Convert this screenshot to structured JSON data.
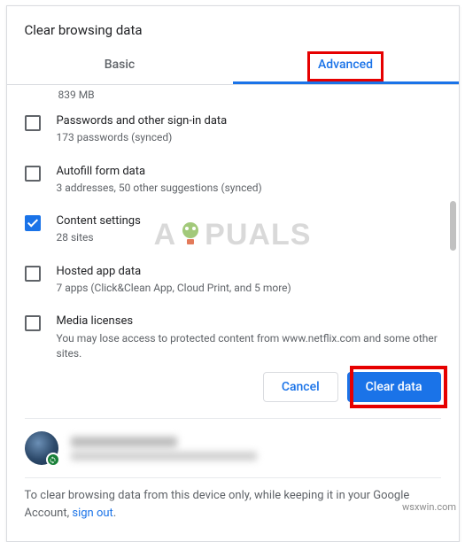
{
  "title": "Clear browsing data",
  "tabs": {
    "basic": "Basic",
    "advanced": "Advanced"
  },
  "truncated_top": "839 MB",
  "items": [
    {
      "id": "passwords",
      "checked": false,
      "title": "Passwords and other sign-in data",
      "sub": "173 passwords (synced)"
    },
    {
      "id": "autofill",
      "checked": false,
      "title": "Autofill form data",
      "sub": "3 addresses, 50 other suggestions (synced)"
    },
    {
      "id": "content-settings",
      "checked": true,
      "title": "Content settings",
      "sub": "28 sites"
    },
    {
      "id": "hosted-app",
      "checked": false,
      "title": "Hosted app data",
      "sub": "7 apps (Click&Clean App, Cloud Print, and 5 more)"
    },
    {
      "id": "media-licenses",
      "checked": false,
      "title": "Media licenses",
      "sub": "You may lose access to protected content from www.netflix.com and some other sites."
    }
  ],
  "buttons": {
    "cancel": "Cancel",
    "clear": "Clear data"
  },
  "footer": {
    "text_a": "To clear browsing data from this device only, while keeping it in your Google Account, ",
    "link": "sign out",
    "text_b": "."
  },
  "watermark": {
    "pre": "A",
    "post": "PUALS"
  },
  "source": "wsxwin.com"
}
